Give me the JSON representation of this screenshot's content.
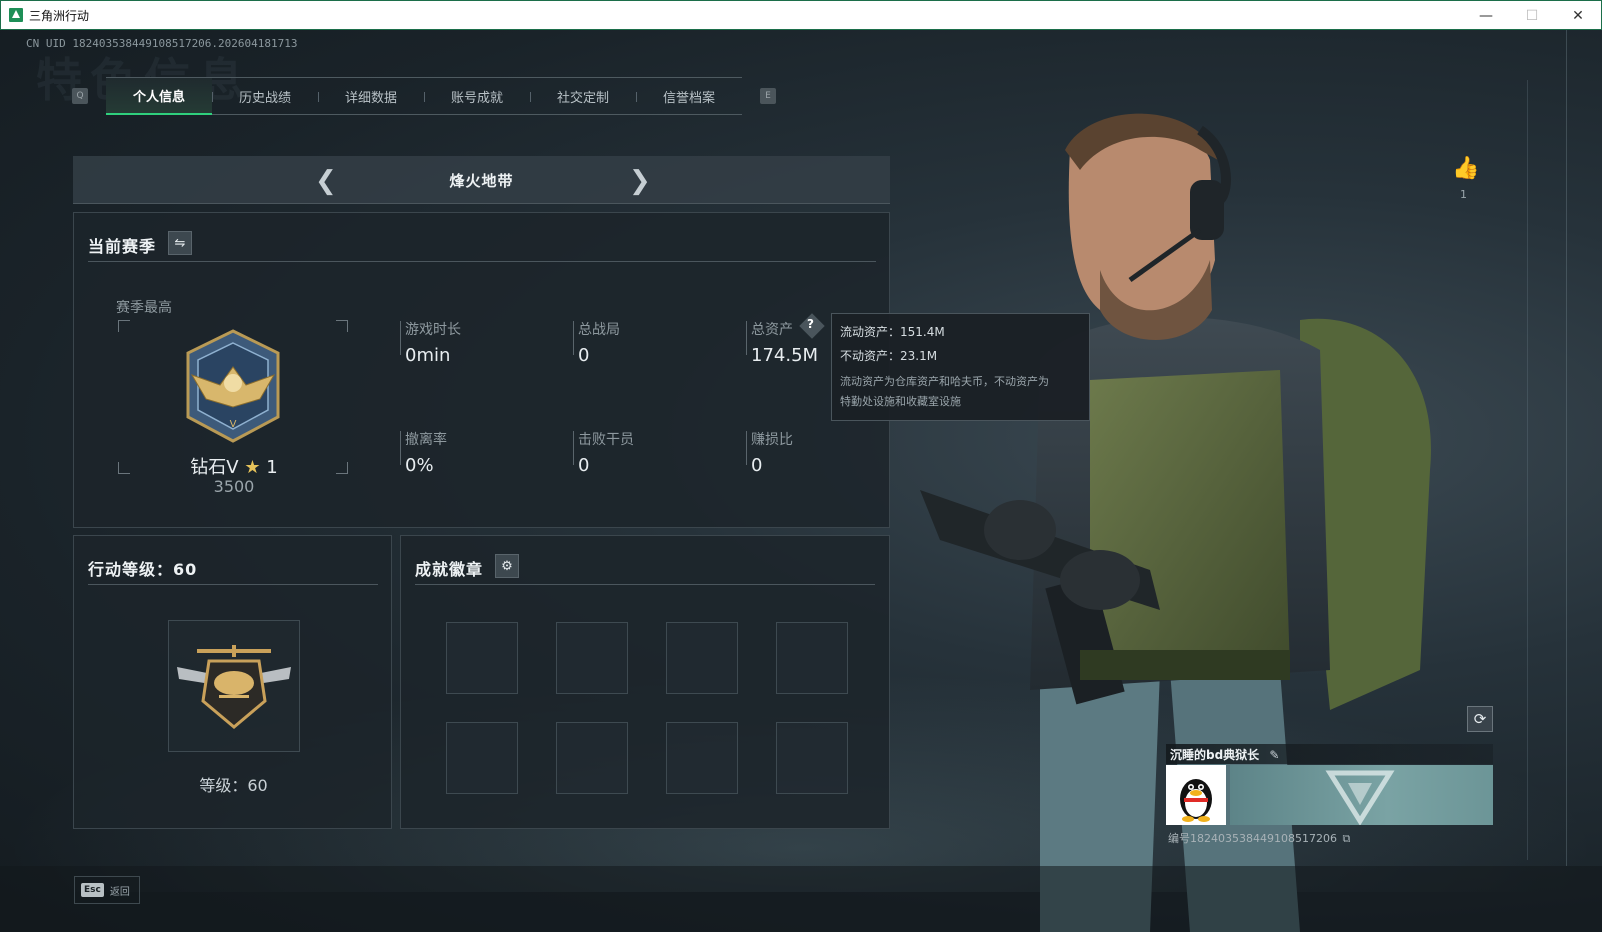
{
  "window": {
    "title": "三角洲行动",
    "controls": {
      "minimize": "—",
      "maximize": "☐",
      "close": "✕"
    }
  },
  "uid_line": "CN UID 1824035384491085172​06.202604181713",
  "ghost_title": "特色信息",
  "tabs": {
    "left_key": "Q",
    "right_key": "E",
    "items": [
      {
        "label": "个人信息",
        "active": true
      },
      {
        "label": "历史战绩",
        "active": false
      },
      {
        "label": "详细数据",
        "active": false
      },
      {
        "label": "账号成就",
        "active": false
      },
      {
        "label": "社交定制",
        "active": false
      },
      {
        "label": "信誉档案",
        "active": false
      }
    ]
  },
  "mode_selector": {
    "name": "烽火地带",
    "prev_icon": "chevron-left-icon",
    "next_icon": "chevron-right-icon"
  },
  "season": {
    "heading": "当前赛季",
    "swap_icon": "⇋",
    "best_label": "赛季最高",
    "rank_name": "钻石V",
    "rank_star": "★",
    "rank_stars_count": "1",
    "rank_points": "3500",
    "stats": {
      "play_time": {
        "label": "游戏时长",
        "value": "0min"
      },
      "total_games": {
        "label": "总战局",
        "value": "0"
      },
      "total_assets": {
        "label": "总资产",
        "value": "174.5M",
        "help": "?"
      },
      "extract_rate": {
        "label": "撤离率",
        "value": "0%"
      },
      "kills": {
        "label": "击败干员",
        "value": "0"
      },
      "profit_ratio": {
        "label": "赚损比",
        "value": "0"
      }
    }
  },
  "asset_tooltip": {
    "liquid": "流动资产：151.4M",
    "fixed": "不动资产：23.1M",
    "desc_line1": "流动资产为仓库资产和哈夫币，不动资产为",
    "desc_line2": "特勤处设施和收藏室设施"
  },
  "level_panel": {
    "heading": "行动等级：60",
    "level_label": "等级：60"
  },
  "badges_panel": {
    "heading": "成就徽章",
    "gear_icon": "⚙",
    "slot_count": 8
  },
  "likes": {
    "icon": "thumbs-up-icon",
    "count": "1"
  },
  "player_card": {
    "name": "沉睡的bd典狱长",
    "edit_icon": "✎",
    "id_line": "编号1824035384491085172​06"
  },
  "esc": {
    "key": "Esc",
    "label": "返回"
  },
  "colors": {
    "accent": "#2fd07d",
    "panel": "#1c242a",
    "text": "#e8edf0"
  }
}
